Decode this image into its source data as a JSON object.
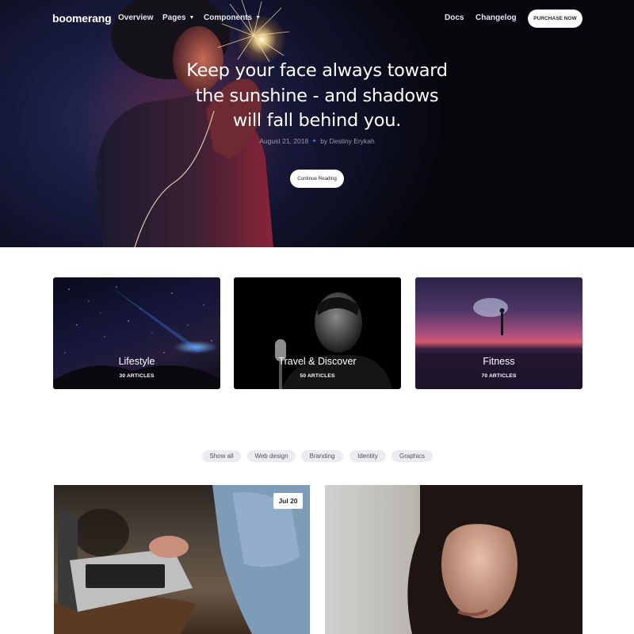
{
  "nav": {
    "logo": "boomerang",
    "links": [
      "Overview",
      "Pages",
      "Components"
    ],
    "right_links": [
      "Docs",
      "Changelog"
    ],
    "cta": "PURCHASE NOW"
  },
  "hero": {
    "quote_lines": [
      "Keep your face always toward",
      "the sunshine - and shadows",
      "will fall behind you."
    ],
    "date": "August 21, 2018",
    "author": "by Destiny Erykah",
    "button": "Continue Reading"
  },
  "categories": [
    {
      "title": "Lifestyle",
      "count": "30 ARTICLES"
    },
    {
      "title": "Travel & Discover",
      "count": "50 ARTICLES"
    },
    {
      "title": "Fitness",
      "count": "70 ARTICLES"
    }
  ],
  "filters": [
    "Show all",
    "Web design",
    "Branding",
    "Identity",
    "Graphics"
  ],
  "posts": [
    {
      "date": "Jul 20"
    }
  ],
  "colors": {
    "accent": "#4b67ff",
    "hero_bg": "#07070d",
    "pill_bg": "#ececee"
  }
}
